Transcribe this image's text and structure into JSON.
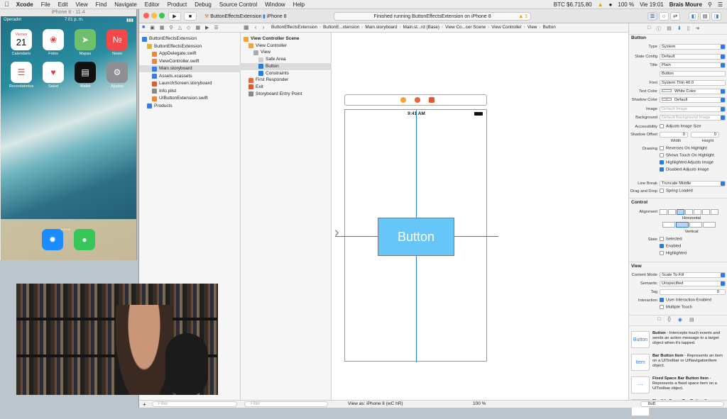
{
  "menubar": {
    "items": [
      "Xcode",
      "File",
      "Edit",
      "View",
      "Find",
      "Navigate",
      "Editor",
      "Product",
      "Debug",
      "Source Control",
      "Window",
      "Help"
    ],
    "btc": "BTC $6.715,80",
    "battery": "100 %",
    "clock": "Vie 19:01",
    "user": "Brais Moure"
  },
  "simulator": {
    "title": "iPhone 8 - 11.4",
    "carrier": "Operador",
    "time": "7:01 p. m.",
    "date_day": "Viernes",
    "date_num": "21",
    "apps": [
      {
        "name": "Calendario",
        "color": "#ffffff"
      },
      {
        "name": "Fotos",
        "color": "#ffffff"
      },
      {
        "name": "Mapas",
        "color": "#6fc06a"
      },
      {
        "name": "News",
        "color": "#f0484b"
      },
      {
        "name": "Recordatorios",
        "color": "#ffffff"
      },
      {
        "name": "Salud",
        "color": "#ffffff"
      },
      {
        "name": "Wallet",
        "color": "#111111"
      },
      {
        "name": "Ajustes",
        "color": "#8e8e93"
      }
    ]
  },
  "toolbar": {
    "scheme": "ButtonEffectsExtension",
    "device": "iPhone 8",
    "status": "Finished running ButtonEffectsExtension on iPhone 8",
    "warnings": "1"
  },
  "jumpbar": {
    "crumbs": [
      "ButtonEffectsExtension",
      "ButtonE...xtension",
      "Main.storyboard",
      "Main.st...rd (Base)",
      "View Co...cer Scene",
      "View Controller",
      "View",
      "Button"
    ]
  },
  "navigator": {
    "items": [
      {
        "label": "ButtonEffectsExtension",
        "indent": 0
      },
      {
        "label": "ButtonEffectsExtension",
        "indent": 1
      },
      {
        "label": "AppDelegate.swift",
        "indent": 2
      },
      {
        "label": "ViewController.swift",
        "indent": 2
      },
      {
        "label": "Main.storyboard",
        "indent": 2
      },
      {
        "label": "Assets.xcassets",
        "indent": 2
      },
      {
        "label": "LaunchScreen.storyboard",
        "indent": 2
      },
      {
        "label": "Info.plist",
        "indent": 2
      },
      {
        "label": "UIButtonExtension.swift",
        "indent": 2
      },
      {
        "label": "Products",
        "indent": 1
      }
    ],
    "filter": "Filter"
  },
  "outline": {
    "items": [
      {
        "label": "View Controller Scene",
        "indent": 0
      },
      {
        "label": "View Controller",
        "indent": 1
      },
      {
        "label": "View",
        "indent": 2
      },
      {
        "label": "Safe Area",
        "indent": 3
      },
      {
        "label": "Button",
        "indent": 3
      },
      {
        "label": "Constraints",
        "indent": 3
      },
      {
        "label": "First Responder",
        "indent": 1
      },
      {
        "label": "Exit",
        "indent": 1
      },
      {
        "label": "Storyboard Entry Point",
        "indent": 1
      }
    ],
    "filter": "Filter"
  },
  "canvas": {
    "status_time": "9:41 AM",
    "button_title": "Button",
    "view_as": "View as: iPhone 8 (wC hR)",
    "zoom": "100 %"
  },
  "inspector": {
    "button_section": "Button",
    "type_label": "Type",
    "type": "System",
    "state_config_label": "State Config",
    "state_config": "Default",
    "title_label": "Title",
    "title_type": "Plain",
    "title_text": "Button",
    "font_label": "Font",
    "font": "System Thin 40.0",
    "text_color_label": "Text Color",
    "text_color": "White Color",
    "shadow_color_label": "Shadow Color",
    "shadow_color": "Default",
    "image_label": "Image",
    "image_placeholder": "Default Image",
    "background_label": "Background",
    "background_placeholder": "Default Background Image",
    "accessibility_label": "Accessibility",
    "accessibility": "Adjusts Image Size",
    "shadow_offset_label": "Shadow Offset",
    "shadow_w": "0",
    "shadow_h": "0",
    "width_label": "Width",
    "height_label": "Height",
    "drawing_label": "Drawing",
    "drawing": [
      {
        "label": "Reverses On Highlight",
        "on": false
      },
      {
        "label": "Shows Touch On Highlight",
        "on": false
      },
      {
        "label": "Highlighted Adjusts Image",
        "on": true
      },
      {
        "label": "Disabled Adjusts Image",
        "on": true
      }
    ],
    "line_break_label": "Line Break",
    "line_break": "Truncate Middle",
    "drag_drop_label": "Drag and Drop",
    "drag_drop": "Spring Loaded",
    "control_section": "Control",
    "alignment_label": "Alignment",
    "horizontal_label": "Horizontal",
    "vertical_label": "Vertical",
    "state_label": "State",
    "states": [
      {
        "label": "Selected",
        "on": false
      },
      {
        "label": "Enabled",
        "on": true
      },
      {
        "label": "Highlighted",
        "on": false
      }
    ],
    "view_section": "View",
    "content_mode_label": "Content Mode",
    "content_mode": "Scale To Fill",
    "semantic_label": "Semantic",
    "semantic": "Unspecified",
    "tag_label": "Tag",
    "tag": "0",
    "interaction_label": "Interaction",
    "interaction": [
      {
        "label": "User Interaction Enabled",
        "on": true
      },
      {
        "label": "Multiple Touch",
        "on": false
      }
    ]
  },
  "library": {
    "items": [
      {
        "icon": "Button",
        "title": "Button",
        "desc": " - Intercepts touch events and sends an action message to a target object when it's tapped."
      },
      {
        "icon": "Item",
        "title": "Bar Button Item",
        "desc": " - Represents an item on a UIToolbar or UINavigationItem object."
      },
      {
        "icon": "",
        "title": "Fixed Space Bar Button Item",
        "desc": " - Represents a fixed space item on a UIToolbar object."
      },
      {
        "icon": "",
        "title": "Flexible Space Bar Button Item",
        "desc": ""
      }
    ],
    "search": "butt"
  },
  "colors": {
    "accent": "#2a7bde",
    "button_fill": "#66c6f7"
  }
}
